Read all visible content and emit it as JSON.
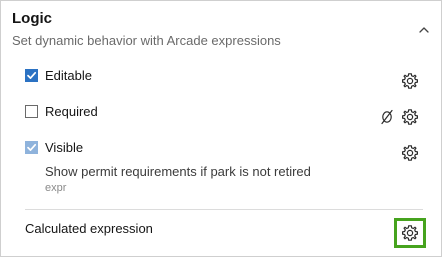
{
  "header": {
    "title": "Logic",
    "subtitle": "Set dynamic behavior with Arcade expressions",
    "collapse_icon": "chevron-up-icon"
  },
  "options": [
    {
      "label": "Editable",
      "checked": true,
      "icons": [
        "gear-icon"
      ]
    },
    {
      "label": "Required",
      "checked": false,
      "icons": [
        "no-expression-icon",
        "gear-icon"
      ]
    },
    {
      "label": "Visible",
      "checked": true,
      "icons": [
        "gear-icon"
      ],
      "expression_name": "Show permit requirements if park is not retired",
      "expression_type": "expr"
    }
  ],
  "calculated": {
    "label": "Calculated expression",
    "icon": "gear-icon",
    "highlight_color": "#46a31e"
  },
  "colors": {
    "checkbox_checked": "#2b72c3",
    "highlight": "#46a31e"
  }
}
